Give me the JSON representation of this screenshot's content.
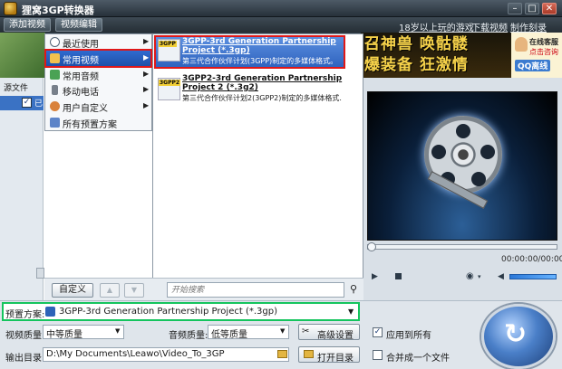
{
  "app": {
    "title": "狸窝3GP转换器"
  },
  "window_controls": {
    "minimize": "–",
    "maximize": "□",
    "close": "✕"
  },
  "toolbar": {
    "add_video": "添加视频",
    "edit_video": "视频编辑"
  },
  "top_links": {
    "games": "18岁以上玩的游戏",
    "download": "下载视频",
    "dvd": "制作刻录DVD"
  },
  "ad": {
    "line1": "召神兽 唤骷髅",
    "line2": "爆装备 狂激情",
    "service_t1": "在线客服",
    "service_t2": "点击咨询",
    "qq": "QQ离线"
  },
  "file_panel": {
    "header": "源文件",
    "file_name": "已",
    "checked": "✓"
  },
  "menu": {
    "items": [
      {
        "label": "最近使用",
        "arrow": "▶"
      },
      {
        "label": "常用视频",
        "arrow": "▶"
      },
      {
        "label": "常用音频",
        "arrow": "▶"
      },
      {
        "label": "移动电话",
        "arrow": "▶"
      },
      {
        "label": "用户自定义",
        "arrow": "▶"
      },
      {
        "label": "所有预置方案",
        "arrow": ""
      }
    ],
    "custom_button": "自定义",
    "up": "▲",
    "down": "▼",
    "search_placeholder": "开始搜索",
    "search_icon": "⚲"
  },
  "submenu": {
    "items": [
      {
        "badge": "3GPP",
        "title": "3GPP-3rd Generation Partnership Project (*.3gp)",
        "desc": "第三代合作伙伴计划(3GPP)制定的多媒体格式。"
      },
      {
        "badge": "3GPP2",
        "title": "3GPP2-3rd Generation Partnership Project 2 (*.3g2)",
        "desc": "第三代合作伙伴计划2(3GPP2)制定的多媒体格式."
      }
    ]
  },
  "player": {
    "time": "00:00:00/00:00:00",
    "play": "▶",
    "camera": "◉",
    "camera_drop": "▾",
    "volume": "◀"
  },
  "settings": {
    "preset_label": "预置方案:",
    "preset_value": "3GPP-3rd Generation Partnership Project (*.3gp)",
    "dropdown_arrow": "▼",
    "video_quality_label": "视频质量:",
    "video_quality": "中等质量",
    "audio_quality_label": "音频质量:",
    "audio_quality": "低等质量",
    "advanced": "高级设置",
    "advanced_icon": "✂",
    "apply_all": "应用到所有",
    "apply_all_check": "✓",
    "output_label": "输出目录:",
    "output_path": "D:\\My Documents\\Leawo\\Video_To_3GP",
    "open_dir": "打开目录",
    "merge": "合并成一个文件",
    "convert_icon": "↻"
  },
  "colors": {
    "accent_blue": "#2f63bf",
    "highlight_red": "#e01818",
    "preset_green": "#15c45e"
  }
}
